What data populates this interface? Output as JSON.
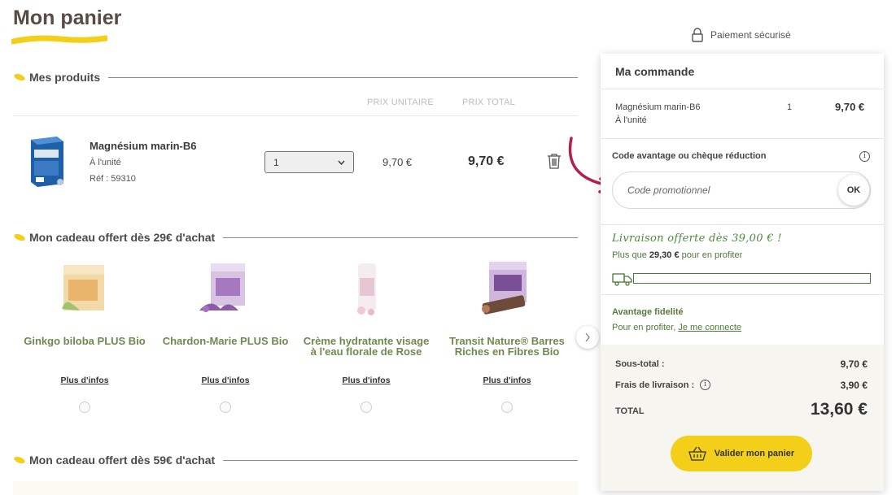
{
  "page": {
    "title": "Mon panier",
    "secure_label": "Paiement sécurisé"
  },
  "products_section": {
    "label": "Mes produits",
    "col_unit_price": "PRIX UNITAIRE",
    "col_total_price": "PRIX TOTAL",
    "items": [
      {
        "name": "Magnésium marin-B6",
        "unit": "À l'unité",
        "ref": "Réf : 59310",
        "qty": "1",
        "unit_price": "9,70 €",
        "total_price": "9,70 €"
      }
    ]
  },
  "gift_section_29": {
    "label": "Mon cadeau offert dès 29€ d'achat",
    "more_label": "Plus d'infos",
    "gifts": [
      {
        "name": "Ginkgo biloba PLUS Bio",
        "more": "Plus d'infos"
      },
      {
        "name": "Chardon-Marie PLUS Bio",
        "more": "Plus d'infos"
      },
      {
        "name": "Crème hydratante visage à l'eau florale de Rose",
        "more": "Plus d'infos"
      },
      {
        "name": "Transit Nature® Barres Riches en Fibres Bio",
        "more": "Plus d'infos"
      }
    ]
  },
  "gift_section_59": {
    "label": "Mon cadeau offert dès 59€ d'achat"
  },
  "order": {
    "title": "Ma commande",
    "item": {
      "name": "Magnésium marin-B6",
      "unit": "À l'unité",
      "qty": "1",
      "price": "9,70 €"
    },
    "promo_label": "Code avantage ou chèque réduction",
    "promo_placeholder": "Code promotionnel",
    "ok_label": "OK",
    "shipping_headline": "Livraison offerte dès 39,00 € !",
    "shipping_prefix": "Plus que",
    "shipping_remaining": "29,30 €",
    "shipping_suffix": "pour en profiter",
    "shipping_progress": 0.0,
    "fidelity_title": "Avantage fidelité",
    "fidelity_prefix": "Pour en profiter,",
    "fidelity_link": "Je me connecte",
    "subtotal_label": "Sous-total :",
    "subtotal_value": "9,70 €",
    "shipping_fee_label": "Frais de livraison :",
    "shipping_fee_value": "3,90 €",
    "total_label": "TOTAL",
    "total_value": "13,60 €",
    "validate_label": "Valider mon panier"
  },
  "colors": {
    "accent_yellow": "#f4cf1a",
    "green": "#4c7a3a",
    "arrow_red": "#b3204f"
  }
}
